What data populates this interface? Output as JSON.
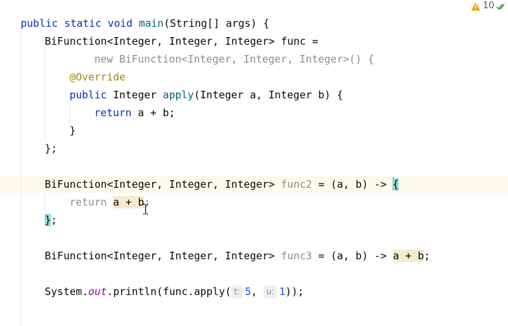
{
  "inspection": {
    "warning_count": "10",
    "warning_color": "#e0a000",
    "check_color": "#3c9a4a",
    "warning_icon": "warning-triangle-icon",
    "check_icon": "double-check-icon"
  },
  "code": {
    "l1": {
      "t1": "public",
      "t2": " ",
      "t3": "static",
      "t4": " ",
      "t5": "void",
      "t6": " ",
      "t7": "main",
      "t8": "(String[] args) {"
    },
    "l2": {
      "t1": "BiFunction<Integer, Integer, Integer> func ="
    },
    "l3": {
      "t1": "new",
      "t2": " BiFunction<Integer, Integer, Integer>() {"
    },
    "l4": {
      "t1": "@Override"
    },
    "l5": {
      "t1": "public",
      "t2": " Integer ",
      "t3": "apply",
      "t4": "(Integer a, Integer b) {"
    },
    "l6": {
      "t1": "return",
      "t2": " a + b;"
    },
    "l7": {
      "t1": "}"
    },
    "l8": {
      "t1": "};"
    },
    "l10": {
      "t1": "BiFunction<Integer, Integer, Integer> ",
      "t2": "func2",
      "t3": " = (a, b) -> ",
      "t4": "{"
    },
    "l11": {
      "t1": "return",
      "t2": " ",
      "t3": "a + b",
      "t4": ";"
    },
    "l12": {
      "t1": "}",
      "t2": ";"
    },
    "l14": {
      "t1": "BiFunction<Integer, Integer, Integer> ",
      "t2": "func3",
      "t3": " = (a, b) -> ",
      "t4": "a + b",
      "t5": ";"
    },
    "l16": {
      "t1": "System.",
      "t2": "out",
      "t3": ".println(func.apply(",
      "h1": "t:",
      "v1": "5",
      "t4": ", ",
      "h2": "u:",
      "v2": "1",
      "t5": "));"
    }
  }
}
